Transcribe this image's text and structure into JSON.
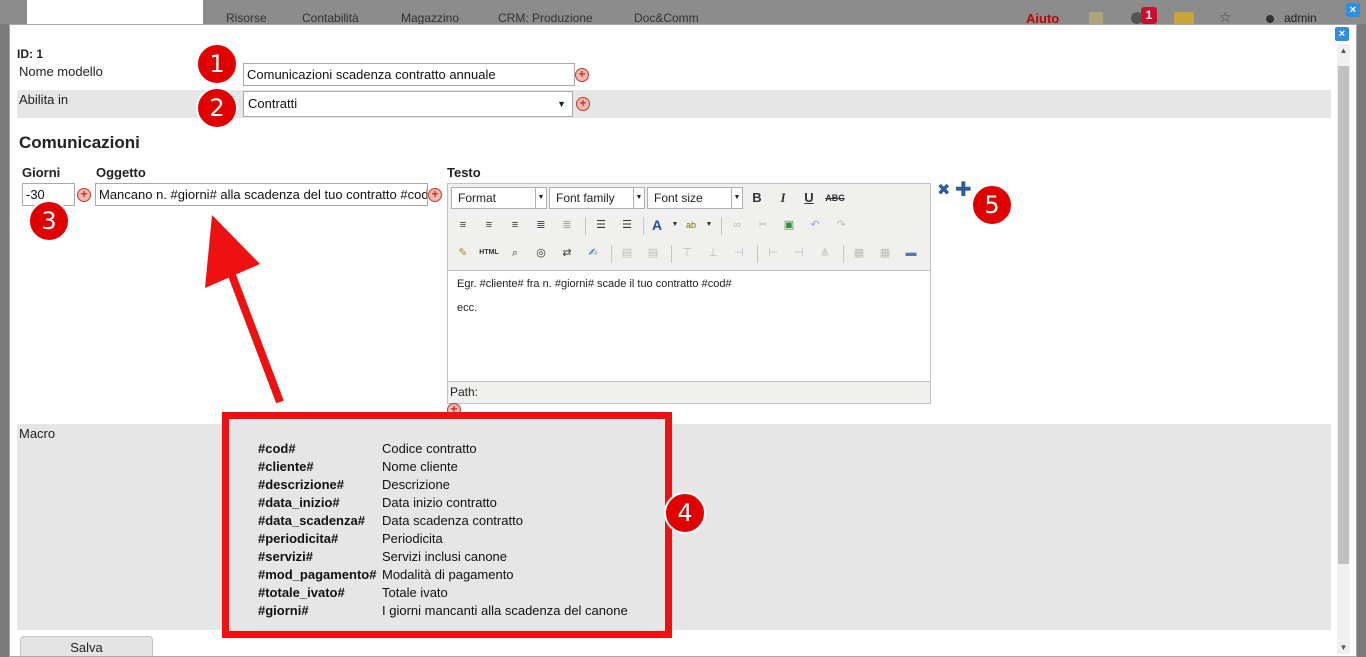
{
  "topbar": {
    "nav": [
      "Risorse",
      "Contabilità",
      "Magazzino",
      "CRM: Produzione",
      "Doc&Comm"
    ],
    "help": "Aiuto",
    "badge": "1",
    "user": "admin",
    "close": "×"
  },
  "modal": {
    "close": "×",
    "id_label": "ID: 1",
    "nome_modello": {
      "label": "Nome modello",
      "value": "Comunicazioni scadenza contratto annuale"
    },
    "abilita_in": {
      "label": "Abilita in",
      "value": "Contratti"
    },
    "section_title": "Comunicazioni",
    "columns": {
      "giorni": "Giorni",
      "oggetto": "Oggetto",
      "testo": "Testo"
    },
    "giorni_value": "-30",
    "oggetto_value": "Mancano n. #giorni# alla scadenza del tuo contratto #cod#",
    "editor": {
      "format": "Format",
      "font_family": "Font family",
      "font_size": "Font size",
      "body_line1": "Egr. #cliente# fra n. #giorni# scade il tuo contratto #cod#",
      "body_line2": "ecc.",
      "path": "Path:"
    },
    "macro_label": "Macro",
    "macros": [
      {
        "code": "#cod#",
        "desc": "Codice contratto"
      },
      {
        "code": "#cliente#",
        "desc": "Nome cliente"
      },
      {
        "code": "#descrizione#",
        "desc": "Descrizione"
      },
      {
        "code": "#data_inizio#",
        "desc": "Data inizio contratto"
      },
      {
        "code": "#data_scadenza#",
        "desc": "Data scadenza contratto"
      },
      {
        "code": "#periodicita#",
        "desc": "Periodicita"
      },
      {
        "code": "#servizi#",
        "desc": "Servizi inclusi canone"
      },
      {
        "code": "#mod_pagamento#",
        "desc": "Modalità di pagamento"
      },
      {
        "code": "#totale_ivato#",
        "desc": "Totale ivato"
      },
      {
        "code": "#giorni#",
        "desc": "I giorni mancanti alla scadenza del canone"
      }
    ],
    "save_label": "Salva"
  },
  "markers": [
    "1",
    "2",
    "3",
    "4",
    "5"
  ],
  "colors": {
    "annotation_red": "#ee1111",
    "close_blue": "#2f8fde",
    "row_shade": "#e6e6e6"
  }
}
